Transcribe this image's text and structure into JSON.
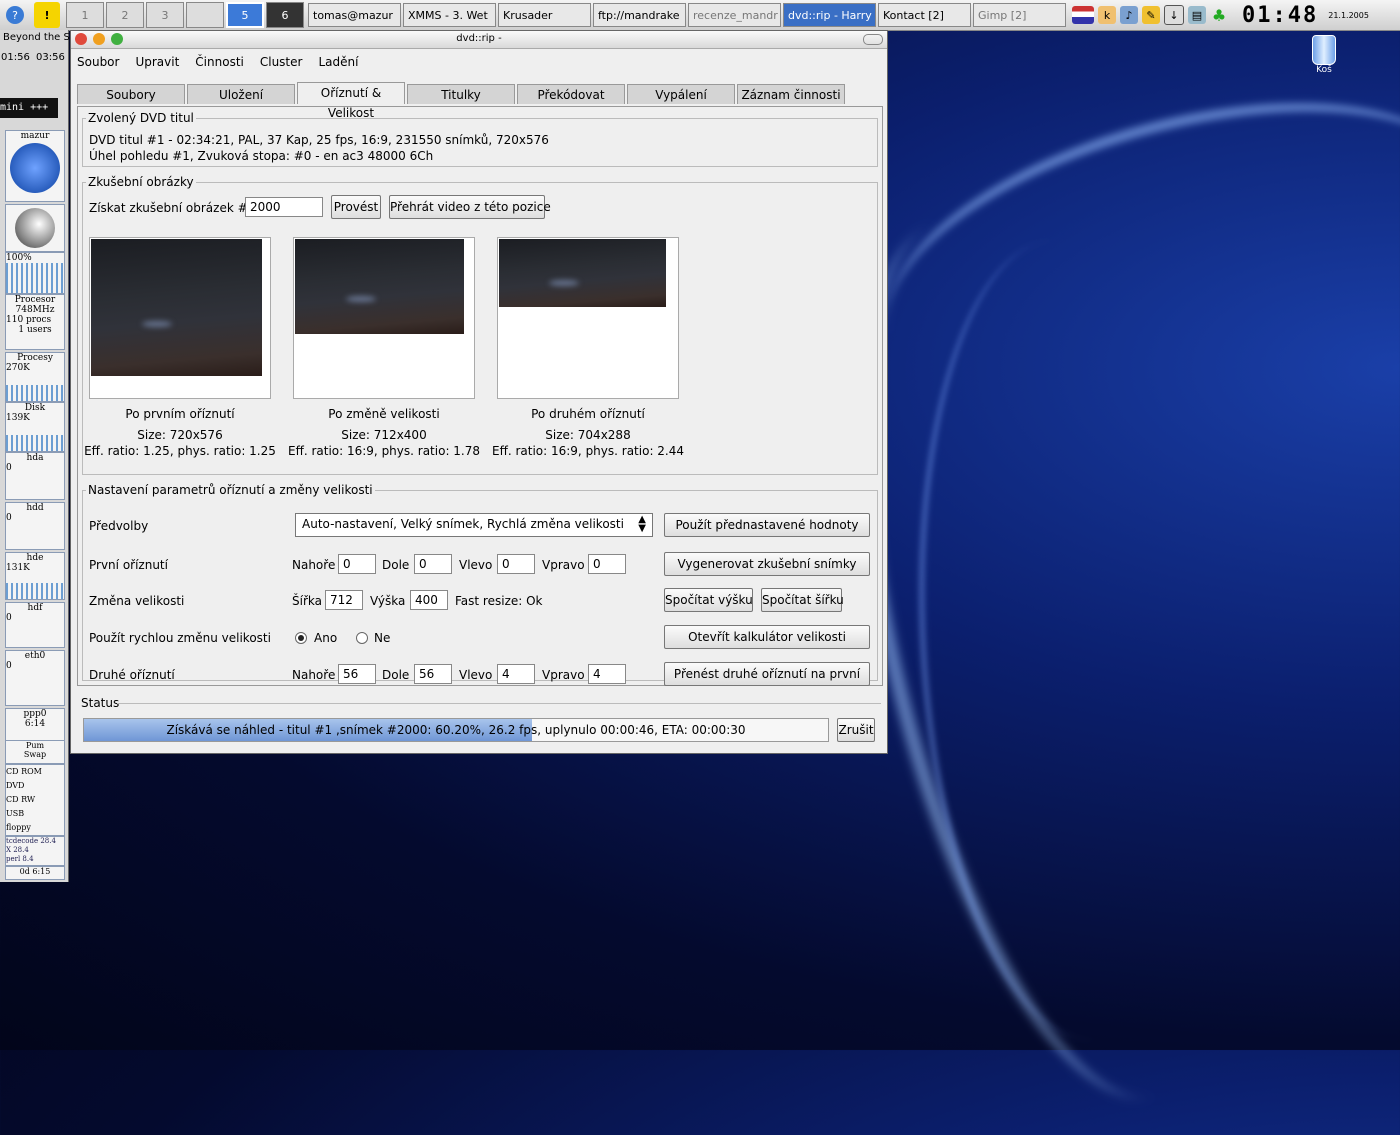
{
  "taskbar": {
    "desktops": [
      "1",
      "2",
      "3",
      "",
      "5",
      "6"
    ],
    "tasks": [
      "tomas@mazur",
      "XMMS - 3. Wet",
      "Krusader",
      "ftp://mandrake",
      "recenze_mandr",
      "dvd::rip - Harry",
      "Kontact [2]",
      "Gimp [2]"
    ],
    "clock": "01:48",
    "date": "21.1.2005"
  },
  "leftpanel": {
    "title": "Beyond the S",
    "times": [
      "01:56",
      "03:56"
    ],
    "mini": "mini +++",
    "host": "mazur",
    "cpu": "100%",
    "proc_label": "Procesor",
    "proc_mhz": "748MHz",
    "procs": "110 procs",
    "users": "1 users",
    "procesy": "Procesy",
    "procesy_val": "270K",
    "disk": "Disk",
    "disk_val": "139K",
    "hda": "hda",
    "hdd": "hdd",
    "hde": "hde",
    "hde_val": "131K",
    "hdf": "hdf",
    "eth0": "eth0",
    "ppp0": "ppp0",
    "zero": "0",
    "time": "6:14",
    "pum": "Pum",
    "swap": "Swap",
    "mounts": [
      "CD ROM",
      "DVD",
      "CD RW",
      "USB",
      "floppy"
    ],
    "versions": [
      "tcdecode 28.4",
      "X 28.4",
      "perl 8.4"
    ],
    "uptime": "0d 6:15"
  },
  "desktop": {
    "trash_label": "Koš"
  },
  "window": {
    "title": "dvd::rip -",
    "menu": [
      "Soubor",
      "Upravit",
      "Činnosti",
      "Cluster",
      "Ladění"
    ],
    "tabs": [
      "Soubory",
      "Uložení",
      "Oříznutí & Velikost",
      "Titulky",
      "Překódovat",
      "Vypálení",
      "Záznam činnosti"
    ],
    "selected_title": {
      "legend": "Zvolený DVD titul",
      "line1": "DVD titul #1 - 02:34:21, PAL, 37 Kap, 25 fps, 16:9, 231550 snímků, 720x576",
      "line2": "Úhel pohledu #1, Zvuková stopa: #0 - en ac3 48000 6Ch"
    },
    "test_images": {
      "legend": "Zkušební obrázky",
      "get_label": "Získat zkušební obrázek  #",
      "frame_value": "2000",
      "run_button": "Provést",
      "play_button": "Přehrát video z této pozice",
      "previews": [
        {
          "caption": "Po prvním oříznutí",
          "size": "Size: 720x576",
          "ratio": "Eff. ratio: 1.25, phys. ratio: 1.25"
        },
        {
          "caption": "Po změně velikosti",
          "size": "Size: 712x400",
          "ratio": "Eff. ratio: 16:9, phys. ratio: 1.78"
        },
        {
          "caption": "Po druhém oříznutí",
          "size": "Size: 704x288",
          "ratio": "Eff. ratio: 16:9, phys. ratio: 2.44"
        }
      ]
    },
    "params": {
      "legend": "Nastavení parametrů oříznutí a změny velikosti",
      "presets_label": "Předvolby",
      "presets_value": "Auto-nastavení, Velký snímek, Rychlá změna velikosti",
      "apply_presets": "Použít přednastavené hodnoty",
      "first_crop": "První oříznutí",
      "top": "Nahoře",
      "bottom": "Dole",
      "left": "Vlevo",
      "right": "Vpravo",
      "first_vals": [
        "0",
        "0",
        "0",
        "0"
      ],
      "generate": "Vygenerovat zkušební snímky",
      "resize": "Změna velikosti",
      "width_label": "Šířka",
      "width_val": "712",
      "height_label": "Výška",
      "height_val": "400",
      "fast_resize": "Fast resize: Ok",
      "calc_height": "Spočítat výšku",
      "calc_width": "Spočítat šířku",
      "fast_label": "Použít rychlou změnu velikosti",
      "yes": "Ano",
      "no": "Ne",
      "open_calc": "Otevřít kalkulátor velikosti",
      "second_crop": "Druhé oříznutí",
      "second_vals": [
        "56",
        "56",
        "4",
        "4"
      ],
      "transfer": "Přenést druhé oříznutí na první"
    },
    "status": {
      "legend": "Status",
      "text": "Získává se náhled - titul #1 ,snímek #2000: 60.20%, 26.2 fps, uplynulo 00:00:46, ETA: 00:00:30",
      "progress": 0.602,
      "cancel": "Zrušit"
    }
  }
}
